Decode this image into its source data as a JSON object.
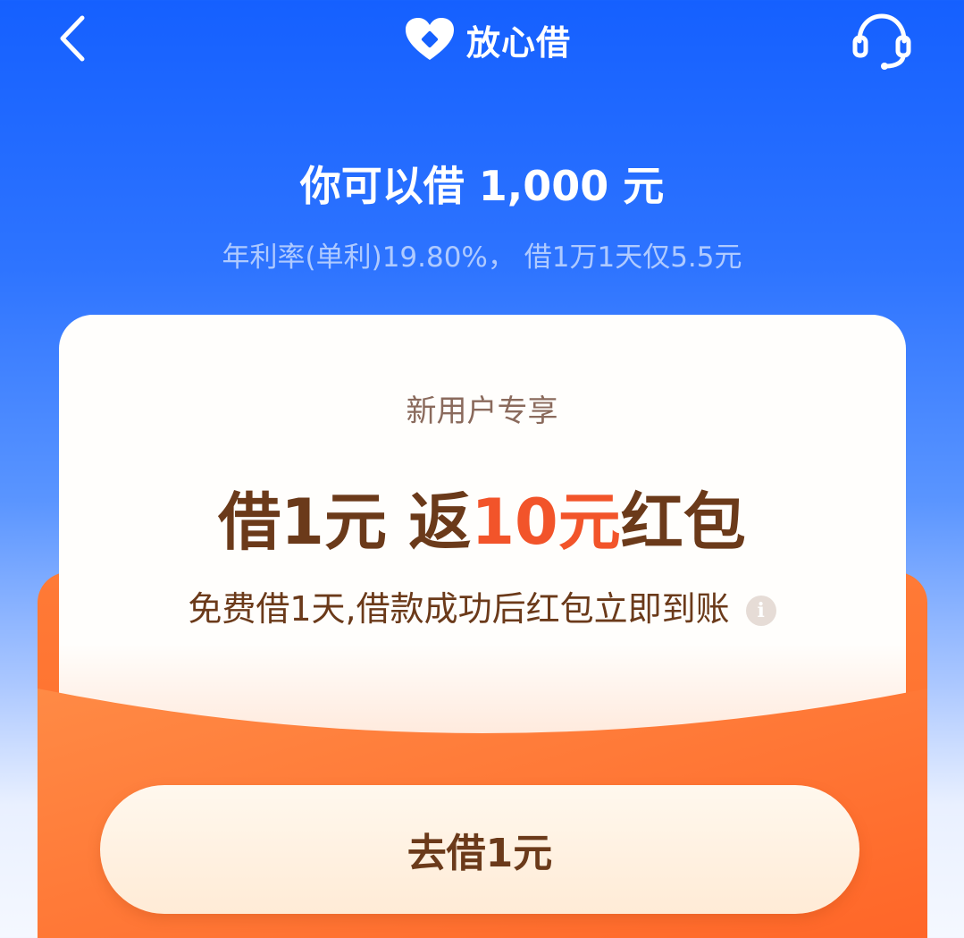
{
  "header": {
    "brand_name": "放心借",
    "back_icon": "back-arrow-icon",
    "service_icon": "customer-service-headset-icon",
    "logo_icon": "heart-logo-icon"
  },
  "loan": {
    "amount_text": "你可以借 1,000 元",
    "rate_text": "年利率(单利)19.80%， 借1万1天仅5.5元"
  },
  "promo": {
    "subtitle": "新用户专享",
    "title_prefix": "借1元 返",
    "title_highlight": "10元",
    "title_suffix": "红包",
    "description": "免费借1天,借款成功后红包立即到账",
    "info_icon": "info-icon",
    "button_label": "去借1元"
  },
  "colors": {
    "brand_blue": "#1560FF",
    "envelope_orange": "#FF6A2A",
    "highlight_red": "#F2542A",
    "text_brown": "#6B3A1A"
  }
}
